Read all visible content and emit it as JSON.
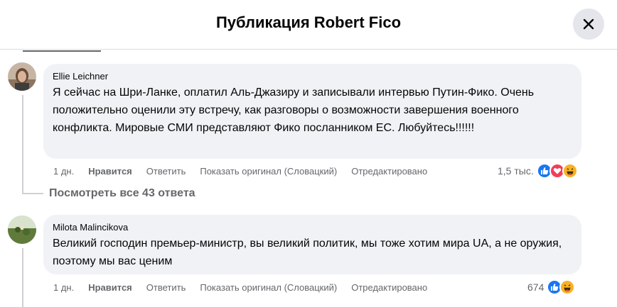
{
  "dialog": {
    "title": "Публикация Robert Fico",
    "close_icon": "close-icon"
  },
  "comments": [
    {
      "author": "Ellie Leichner",
      "text": "Я сейчас на Шри-Ланке, оплатил Аль-Джазиру и записывали интервью Путин-Фико. Очень положительно оценили эту встречу, как разговоры о возможности завершения военного конфликта. Мировые СМИ представляют Фико посланником ЕС. Любуйтесь!!!!!!",
      "time": "1 дн.",
      "like": "Нравится",
      "reply": "Ответить",
      "see_original": "Показать оригинал (Словацкий)",
      "edited": "Отредактировано",
      "reaction_count": "1,5 тыс.",
      "reactions": [
        "like-icon",
        "love-icon",
        "haha-icon"
      ]
    },
    {
      "author": "Milota Malincikova",
      "text": "Великий господин премьер-министр, вы великий политик, мы тоже хотим мира UA, а не оружия, поэтому мы вас ценим",
      "time": "1 дн.",
      "like": "Нравится",
      "reply": "Ответить",
      "see_original": "Показать оригинал (Словацкий)",
      "edited": "Отредактировано",
      "reaction_count": "674",
      "reactions": [
        "like-icon",
        "haha-icon"
      ]
    }
  ],
  "view_replies": "Посмотреть все 43 ответа",
  "colors": {
    "bubble": "#f0f2f5",
    "like_blue": "#1877f2",
    "love_red": "#f33e58",
    "haha_yellow": "#f7b125",
    "secondary_text": "#65676b"
  }
}
